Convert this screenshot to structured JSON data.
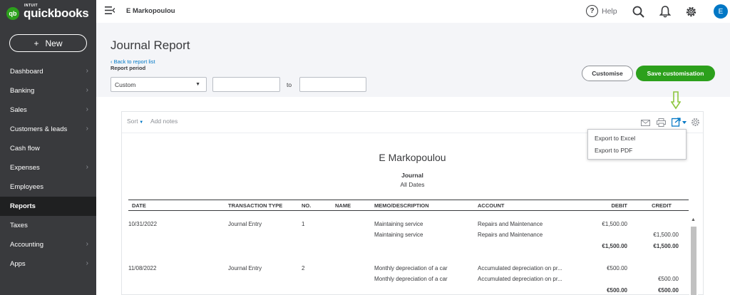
{
  "sidebar": {
    "logo_badge": "qb",
    "logo_small": "INTUIT",
    "logo_text": "quickbooks",
    "new_label": "New",
    "items": [
      {
        "label": "Dashboard",
        "chevron": true
      },
      {
        "label": "Banking",
        "chevron": true
      },
      {
        "label": "Sales",
        "chevron": true
      },
      {
        "label": "Customers & leads",
        "chevron": true
      },
      {
        "label": "Cash flow",
        "chevron": false
      },
      {
        "label": "Expenses",
        "chevron": true
      },
      {
        "label": "Employees",
        "chevron": false
      },
      {
        "label": "Reports",
        "chevron": false,
        "active": true
      },
      {
        "label": "Taxes",
        "chevron": false
      },
      {
        "label": "Accounting",
        "chevron": true
      },
      {
        "label": "Apps",
        "chevron": true
      }
    ]
  },
  "topbar": {
    "company": "E Markopoulou",
    "help_label": "Help",
    "avatar_initial": "E"
  },
  "page": {
    "title": "Journal Report",
    "back_link": "Back to report list",
    "period_label": "Report period",
    "period_value": "Custom",
    "to_label": "to",
    "customise": "Customise",
    "save_customisation": "Save customisation"
  },
  "toolbar": {
    "sort": "Sort",
    "add_notes": "Add notes"
  },
  "export_menu": {
    "excel": "Export to Excel",
    "pdf": "Export to PDF"
  },
  "report": {
    "company": "E Markopoulou",
    "name": "Journal",
    "dates": "All Dates",
    "columns": [
      "DATE",
      "TRANSACTION TYPE",
      "NO.",
      "NAME",
      "MEMO/DESCRIPTION",
      "ACCOUNT",
      "DEBIT",
      "CREDIT"
    ],
    "rows": [
      {
        "date": "10/31/2022",
        "type": "Journal Entry",
        "no": "1",
        "memo": "Maintaining service",
        "account": "Repairs and Maintenance",
        "debit": "€1,500.00",
        "credit": ""
      },
      {
        "date": "",
        "type": "",
        "no": "",
        "memo": "Maintaining service",
        "account": "Repairs and Maintenance",
        "debit": "",
        "credit": "€1,500.00"
      },
      {
        "date": "",
        "type": "",
        "no": "",
        "memo": "",
        "account": "",
        "debit": "€1,500.00",
        "credit": "€1,500.00",
        "total": true
      },
      {
        "date": "11/08/2022",
        "type": "Journal Entry",
        "no": "2",
        "memo": "Monthly depreciation of a car",
        "account": "Accumulated depreciation on pr...",
        "debit": "€500.00",
        "credit": ""
      },
      {
        "date": "",
        "type": "",
        "no": "",
        "memo": "Monthly depreciation of a car",
        "account": "Accumulated depreciation on pr...",
        "debit": "",
        "credit": "€500.00"
      },
      {
        "date": "",
        "type": "",
        "no": "",
        "memo": "",
        "account": "",
        "debit": "€500.00",
        "credit": "€500.00",
        "total": true
      }
    ]
  },
  "colors": {
    "brand_green": "#2ca01c",
    "sidebar": "#393a3d",
    "link_blue": "#0077c5",
    "arrow": "#8dc63f"
  }
}
